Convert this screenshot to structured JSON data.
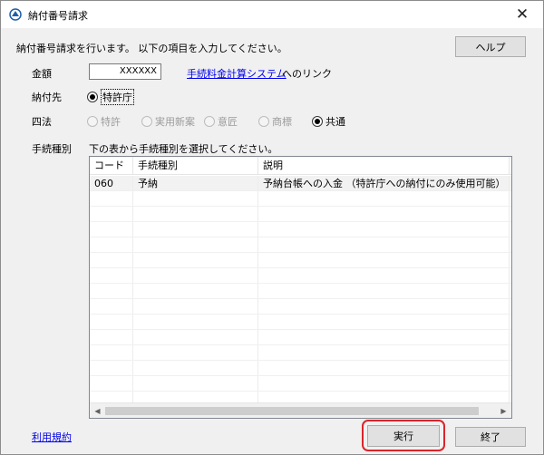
{
  "window": {
    "title": "納付番号請求",
    "close_symbol": "✕"
  },
  "header": {
    "instruction": "納付番号請求を行います。 以下の項目を入力してください。",
    "help_label": "ヘルプ"
  },
  "amount": {
    "label": "金額",
    "value": "XXXXXX",
    "link_text": "手続料金計算システム",
    "link_suffix": "へのリンク"
  },
  "payee": {
    "label": "納付先",
    "option": "特許庁",
    "selected": true
  },
  "law": {
    "label": "四法",
    "options": [
      {
        "label": "特許",
        "checked": false,
        "disabled": true
      },
      {
        "label": "実用新案",
        "checked": false,
        "disabled": true
      },
      {
        "label": "意匠",
        "checked": false,
        "disabled": true
      },
      {
        "label": "商標",
        "checked": false,
        "disabled": true
      },
      {
        "label": "共通",
        "checked": true,
        "disabled": false
      }
    ]
  },
  "procedure": {
    "label": "手続種別",
    "instruction": "下の表から手続種別を選択してください。"
  },
  "table": {
    "columns": [
      "コード",
      "手続種別",
      "説明"
    ],
    "rows": [
      {
        "code": "060",
        "type": "予納",
        "description": "予納台帳への入金 （特許庁への納付にのみ使用可能）"
      }
    ]
  },
  "footer": {
    "terms_link": "利用規約",
    "run_label": "実行",
    "end_label": "終了"
  },
  "colors": {
    "highlight_outline": "#d9252a",
    "link": "#0000ee"
  }
}
